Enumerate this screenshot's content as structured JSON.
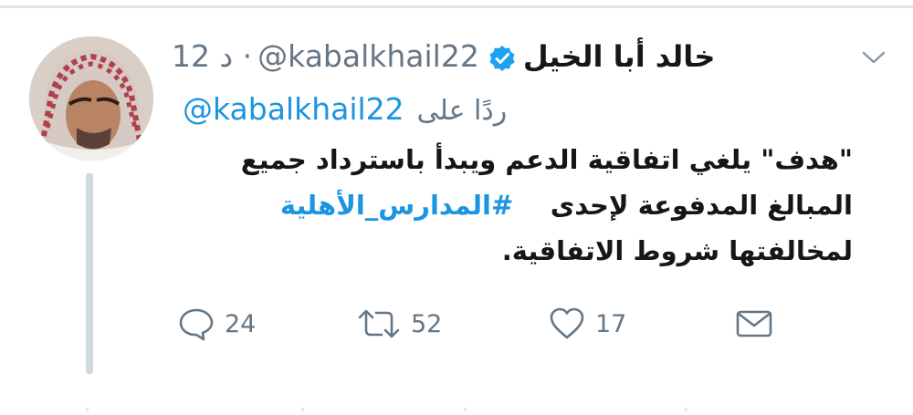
{
  "tweet": {
    "timestamp": "12 د ·",
    "handle": "@kabalkhail22",
    "display_name": "خالد أبا الخيل",
    "verified": true,
    "replying_prefix": "ردًا على",
    "replying_handle": "@kabalkhail22",
    "body_line_1": "\"هدف\" يلغي اتفاقية الدعم ويبدأ باسترداد جميع",
    "body_line_2_text": "المبالغ المدفوعة لإحدى",
    "body_hashtag": "#المدارس_الأهلية",
    "body_line_3": "لمخالفتها شروط الاتفاقية."
  },
  "actions": {
    "reply_count": "24",
    "retweet_count": "52",
    "like_count": "17"
  },
  "icons": {
    "caret": "chevron-down-icon",
    "verified": "verified-badge-icon",
    "reply": "comment-icon",
    "retweet": "retweet-icon",
    "like": "heart-icon",
    "dm": "envelope-icon"
  },
  "colors": {
    "link_blue": "#1b95e0",
    "verified_blue": "#1da1f2",
    "muted_gray": "#657786",
    "thread_line": "#cfd9de"
  }
}
